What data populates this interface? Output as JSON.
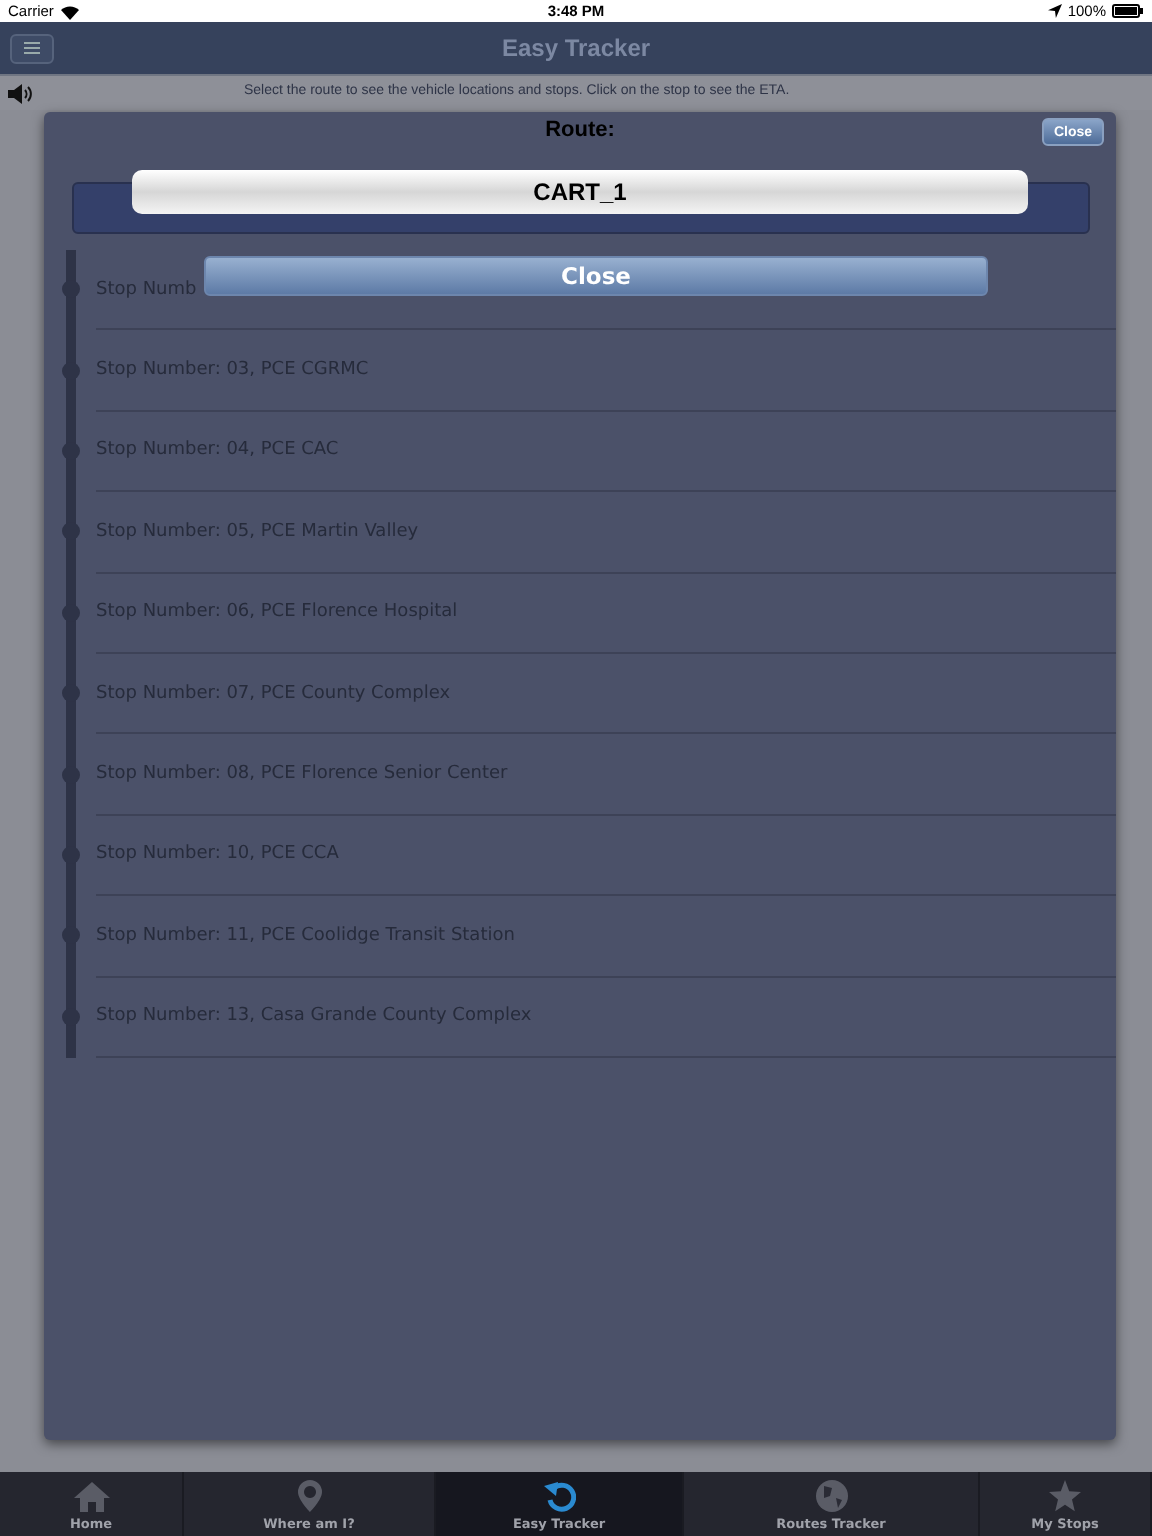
{
  "status_bar": {
    "carrier": "Carrier",
    "time": "3:48 PM",
    "battery": "100%"
  },
  "header": {
    "title": "Easy Tracker",
    "instruction": "Select the route to see the vehicle locations and stops. Click on the stop to see the ETA."
  },
  "dialog": {
    "label": "Route:",
    "close_small": "Close",
    "route_value": "CART_1",
    "close_button": "Close",
    "stops": [
      {
        "text": "Stop Numb"
      },
      {
        "text": "Stop Number: 03, PCE CGRMC"
      },
      {
        "text": "Stop Number: 04, PCE CAC"
      },
      {
        "text": "Stop Number: 05, PCE Martin Valley"
      },
      {
        "text": "Stop Number: 06, PCE Florence Hospital"
      },
      {
        "text": "Stop Number: 07, PCE County Complex"
      },
      {
        "text": "Stop Number: 08, PCE Florence Senior Center"
      },
      {
        "text": "Stop Number: 10, PCE CCA"
      },
      {
        "text": "Stop Number: 11, PCE Coolidge Transit Station"
      },
      {
        "text": "Stop Number: 13, Casa Grande County Complex"
      }
    ]
  },
  "tab_bar": [
    {
      "label": "Home",
      "kind": "home",
      "selected": false
    },
    {
      "label": "Where am I?",
      "kind": "pin",
      "selected": false
    },
    {
      "label": "Easy Tracker",
      "kind": "refresh",
      "selected": true
    },
    {
      "label": "Routes Tracker",
      "kind": "globe",
      "selected": false
    },
    {
      "label": "My Stops",
      "kind": "star",
      "selected": false
    }
  ]
}
